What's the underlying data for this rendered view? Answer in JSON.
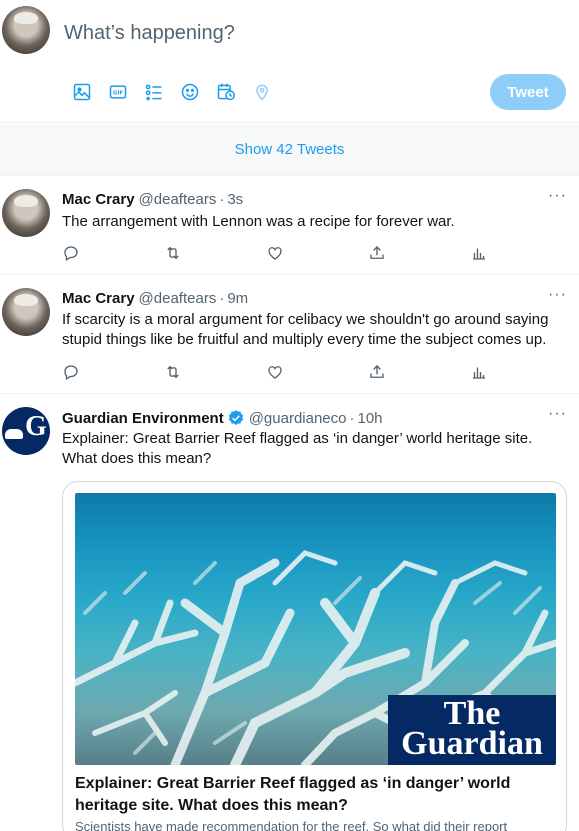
{
  "composer": {
    "placeholder": "What’s happening?",
    "tools": [
      {
        "name": "media-icon"
      },
      {
        "name": "gif-icon"
      },
      {
        "name": "poll-icon"
      },
      {
        "name": "emoji-icon"
      },
      {
        "name": "schedule-icon"
      },
      {
        "name": "location-icon"
      }
    ],
    "tweet_label": "Tweet",
    "accent": "#1d9bf0"
  },
  "show_tweets": "Show 42 Tweets",
  "tweets": [
    {
      "name": "Mac Crary",
      "handle": "@deaftears",
      "time": "3s",
      "text": "The arrangement with Lennon was a recipe for forever war."
    },
    {
      "name": "Mac Crary",
      "handle": "@deaftears",
      "time": "9m",
      "text": "If scarcity is a moral argument for celibacy we shouldn't go around saying stupid things like be fruitful and multiply every time the subject comes up."
    },
    {
      "name": "Guardian Environment",
      "handle": "@guardianeco",
      "time": "10h",
      "text": "Explainer: Great Barrier Reef flagged as ‘in danger’ world heritage site. What does this mean?",
      "card": {
        "badge": "The Guardian",
        "title": "Explainer: Great Barrier Reef flagged as ‘in danger’ world heritage site. What does this mean?",
        "description": "Scientists have made recommendation for the reef. So what did their report"
      }
    }
  ],
  "more_glyph": "···",
  "dot": "·"
}
